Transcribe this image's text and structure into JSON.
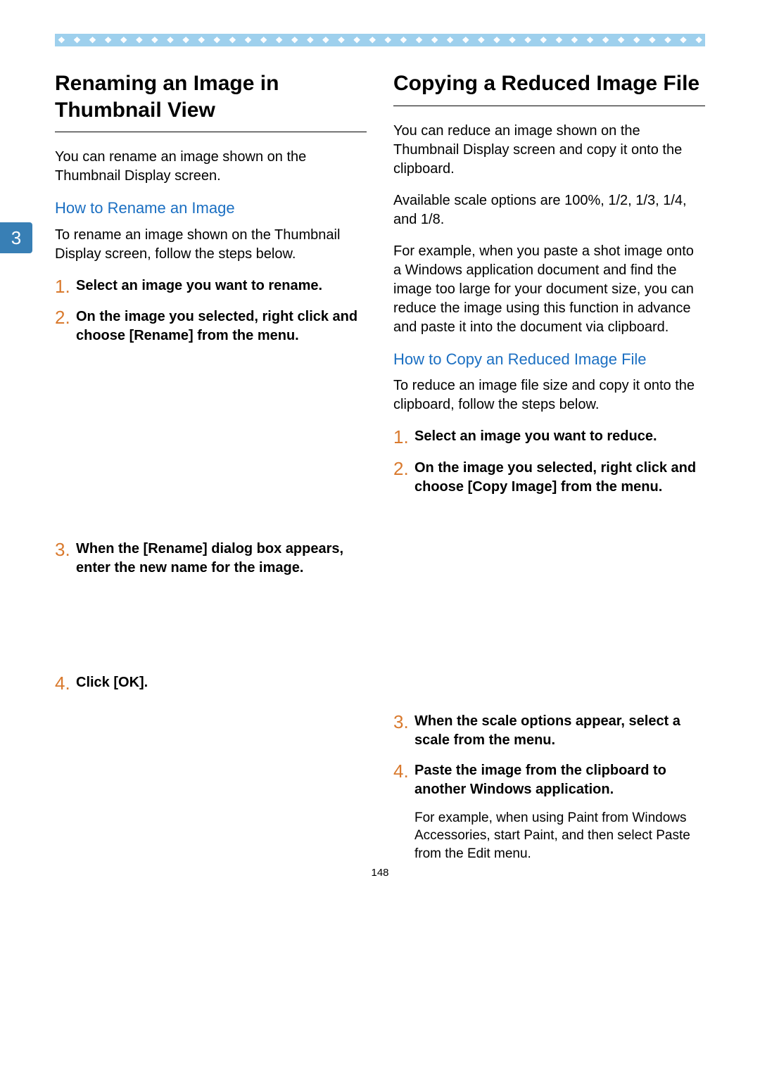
{
  "page_number": "148",
  "chapter_tab": "3",
  "decor": "❖ ❖ ❖ ❖ ❖ ❖ ❖ ❖ ❖ ❖ ❖ ❖ ❖ ❖ ❖ ❖ ❖ ❖ ❖ ❖ ❖ ❖ ❖ ❖ ❖ ❖ ❖ ❖ ❖ ❖ ❖ ❖ ❖ ❖ ❖ ❖ ❖ ❖ ❖ ❖ ❖ ❖ ❖ ❖ ❖ ❖ ❖ ❖ ❖ ❖ ❖ ❖ ❖",
  "left": {
    "title": "Renaming an Image in Thumbnail View",
    "intro": "You can rename an image shown on the Thumbnail Display screen.",
    "sub": "How to Rename an Image",
    "sub_intro": "To rename an image shown on the Thumbnail Display screen, follow the steps below.",
    "steps": {
      "s1": {
        "num": "1.",
        "text": "Select an image you want to rename."
      },
      "s2": {
        "num": "2.",
        "text": "On the image you selected, right click and choose [Rename] from the menu."
      },
      "s3": {
        "num": "3.",
        "text": "When the [Rename] dialog box appears, enter the new name for the image."
      },
      "s4": {
        "num": "4.",
        "text": "Click [OK]."
      }
    }
  },
  "right": {
    "title": "Copying a Reduced Image File",
    "intro1": "You can reduce an image shown on the Thumbnail Display screen and copy it onto the clipboard.",
    "intro2": "Available scale options are 100%, 1/2, 1/3, 1/4, and 1/8.",
    "intro3": "For example, when you paste a shot image onto a Windows application document and find the image too large for your document size, you can reduce the image using this function in advance and paste it into the document via clipboard.",
    "sub": "How to Copy an Reduced Image File",
    "sub_intro": "To reduce an image file size and copy it onto the clipboard, follow the steps below.",
    "steps": {
      "s1": {
        "num": "1.",
        "text": "Select an image you want to reduce."
      },
      "s2": {
        "num": "2.",
        "text": "On the image you selected, right click and choose [Copy Image] from the menu."
      },
      "s3": {
        "num": "3.",
        "text": "When the scale options appear, select a scale from the menu."
      },
      "s4": {
        "num": "4.",
        "text": "Paste the image from the clipboard to another Windows application.",
        "note": "For example, when using Paint from Windows Accessories, start Paint, and then select Paste from the Edit menu."
      }
    }
  }
}
